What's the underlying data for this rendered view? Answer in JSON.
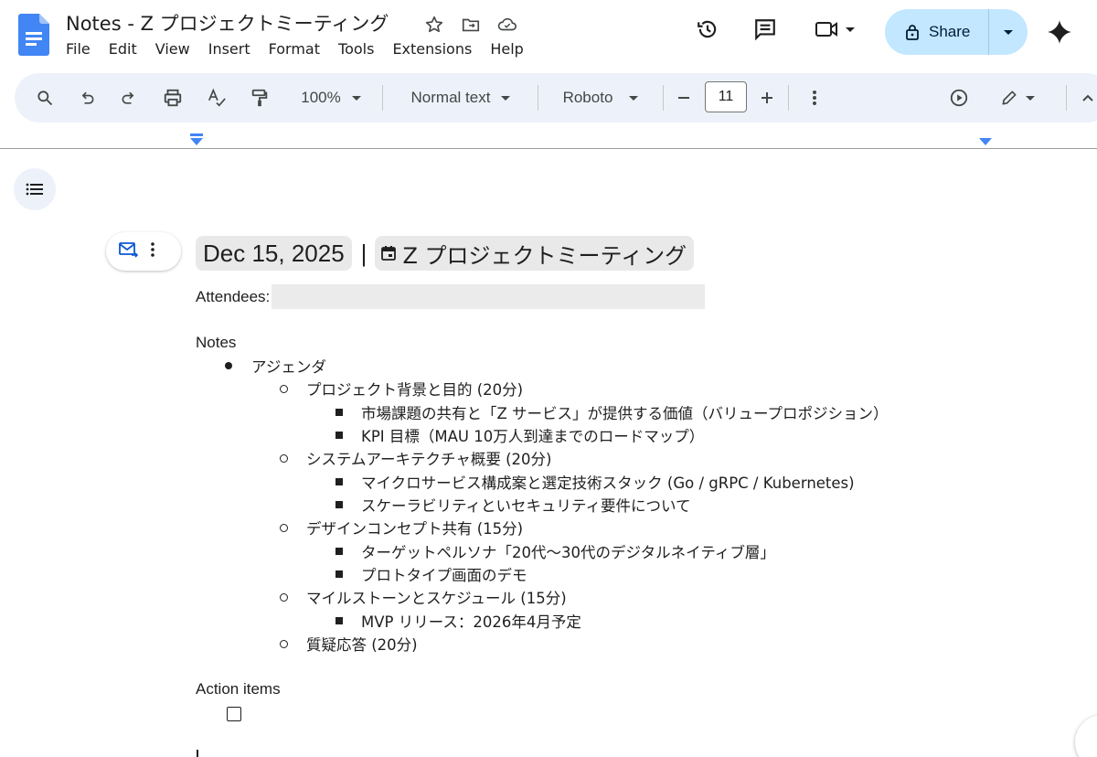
{
  "app": {
    "doc_title": "Notes - Z プロジェクトミーティング",
    "menus": [
      "File",
      "Edit",
      "View",
      "Insert",
      "Format",
      "Tools",
      "Extensions",
      "Help"
    ],
    "share_label": "Share",
    "brand_color": "#4285f4",
    "share_bg": "#c2e7ff"
  },
  "toolbar": {
    "zoom": "100%",
    "style": "Normal text",
    "font": "Roboto",
    "font_size": "11"
  },
  "document": {
    "date_chip": "Dec 15, 2025",
    "separator": "|",
    "meeting_chip": "Z プロジェクトミーティング",
    "attendees_label": "Attendees:",
    "notes_label": "Notes",
    "agenda": "アジェンダ",
    "items": [
      "プロジェクト背景と目的 (20分)",
      "市場課題の共有と「Z サービス」が提供する価値（バリュープロポジション）",
      "KPI 目標（MAU 10万人到達までのロードマップ）",
      "システムアーキテクチャ概要 (20分)",
      "マイクロサービス構成案と選定技術スタック (Go / gRPC / Kubernetes)",
      "スケーラビリティといセキュリティ要件について",
      "デザインコンセプト共有 (15分)",
      "ターゲットペルソナ「20代〜30代のデジタルネイティブ層」",
      "プロトタイプ画面のデモ",
      "マイルストーンとスケジュール (15分)",
      "MVP リリース：2026年4月予定",
      "質疑応答 (20分)"
    ],
    "action_items_label": "Action items"
  }
}
